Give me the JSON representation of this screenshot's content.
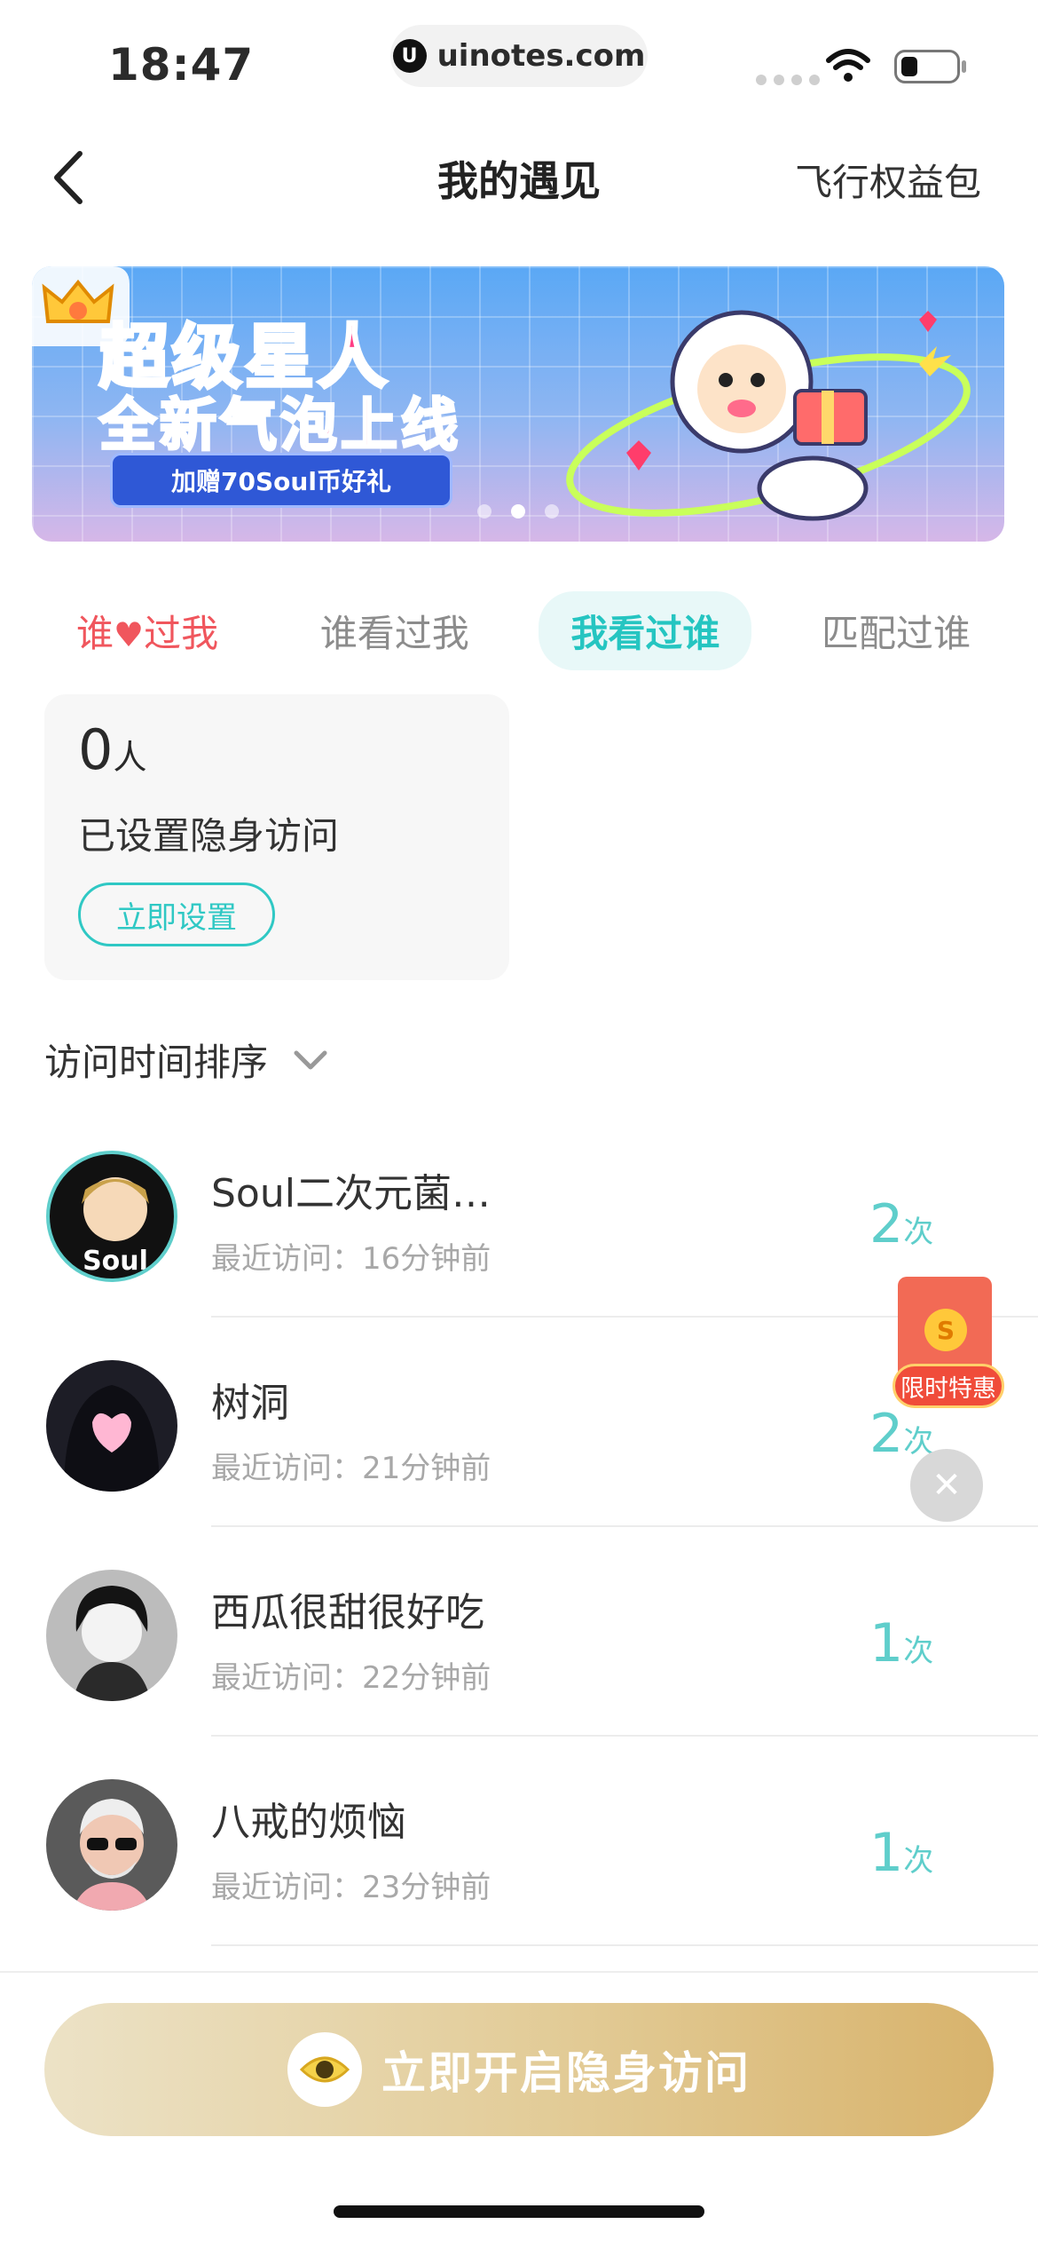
{
  "status_bar": {
    "time": "18:47",
    "url": "uinotes.com",
    "url_icon": "U"
  },
  "nav": {
    "title": "我的遇见",
    "right_link": "飞行权益包"
  },
  "banner": {
    "line1": "超级星人",
    "line2": "全新气泡上线",
    "tag": "加赠70Soul币好礼",
    "page_count": 3,
    "active_page": 2
  },
  "tabs": [
    {
      "label_a": "谁",
      "label_b": "过我",
      "icon": "heart-icon"
    },
    {
      "label": "谁看过我"
    },
    {
      "label": "我看过谁"
    },
    {
      "label": "匹配过谁"
    }
  ],
  "card": {
    "count": "0",
    "unit": "人",
    "desc": "已设置隐身访问",
    "button": "立即设置"
  },
  "sort": {
    "label": "访问时间排序"
  },
  "visitors": [
    {
      "name": "Soul二次元菌…",
      "meta": "最近访问：16分钟前",
      "count": "2",
      "unit": "次"
    },
    {
      "name": "树洞",
      "meta": "最近访问：21分钟前",
      "count": "2",
      "unit": "次"
    },
    {
      "name": "西瓜很甜很好吃",
      "meta": "最近访问：22分钟前",
      "count": "1",
      "unit": "次"
    },
    {
      "name": "八戒的烦恼",
      "meta": "最近访问：23分钟前",
      "count": "1",
      "unit": "次"
    }
  ],
  "promo": {
    "label": "限时特惠",
    "coin": "S"
  },
  "cta": {
    "label": "立即开启隐身访问"
  },
  "colors": {
    "accent": "#25c5c1",
    "red": "#f0565d",
    "gold": "#d8b36c"
  }
}
